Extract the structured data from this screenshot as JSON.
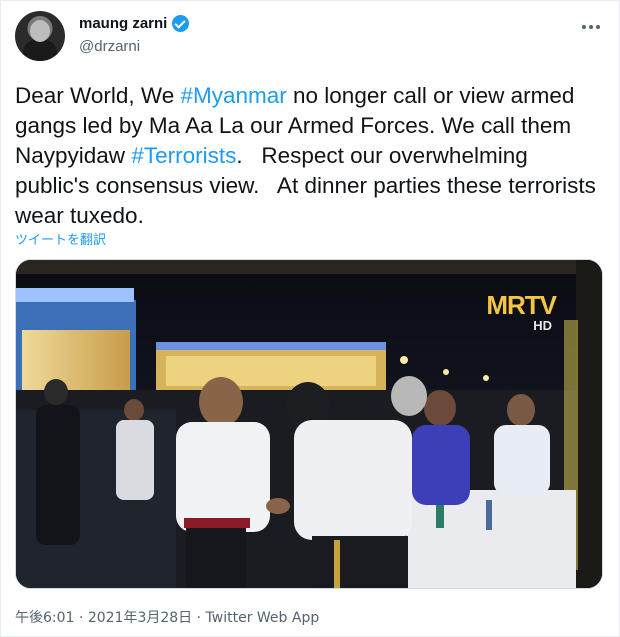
{
  "author": {
    "display_name": "maung zarni",
    "handle": "@drzarni",
    "verified": true
  },
  "tweet": {
    "segments": [
      {
        "text": "Dear World, We ",
        "type": "text"
      },
      {
        "text": "#Myanmar",
        "type": "hashtag"
      },
      {
        "text": " no longer call or view armed gangs led by Ma Aa La our Armed Forces. We call them Naypyidaw ",
        "type": "text"
      },
      {
        "text": "#Terrorists",
        "type": "hashtag"
      },
      {
        "text": ".   Respect our overwhelming public's consensus view.   At dinner parties these terrorists wear tuxedo.",
        "type": "text"
      }
    ],
    "translate_link": "ツイートを翻訳"
  },
  "media": {
    "logo_text_m": "M",
    "logo_text_rtv": "RTV",
    "logo_sub": "HD"
  },
  "meta": {
    "time": "午後6:01",
    "separator": " · ",
    "date": "2021年3月28日",
    "app": "Twitter Web App"
  },
  "colors": {
    "link": "#1d9bf0",
    "verified_badge": "#1d9bf0",
    "secondary_text": "#536471"
  }
}
